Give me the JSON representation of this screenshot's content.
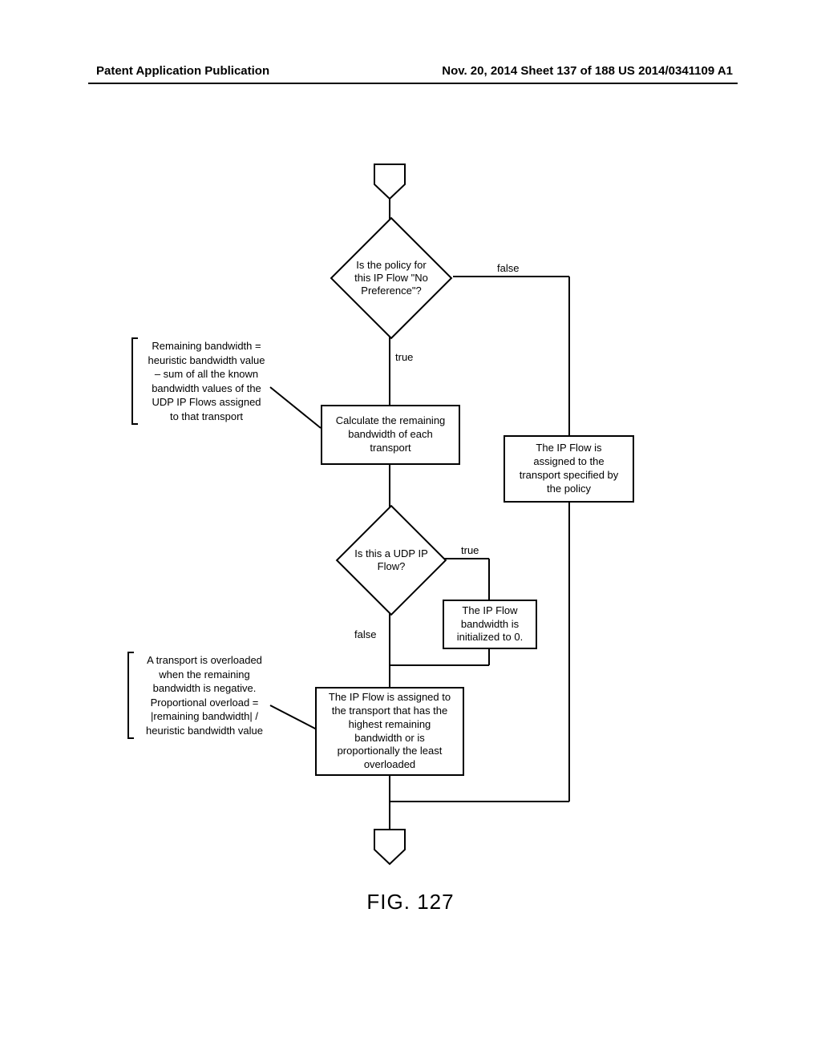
{
  "header": {
    "left": "Patent Application Publication",
    "right": "Nov. 20, 2014  Sheet 137 of 188   US 2014/0341109 A1"
  },
  "decision1": {
    "text": "Is the policy for\nthis IP Flow \"No\nPreference\"?",
    "true_label": "true",
    "false_label": "false"
  },
  "annot_bandwidth": "Remaining bandwidth =\nheuristic bandwidth value\n– sum of all the known\nbandwidth values of the\nUDP IP Flows assigned\nto that transport",
  "process_remaining": "Calculate the remaining\nbandwidth of each\ntransport",
  "process_policy_assign": "The IP Flow is\nassigned to the\ntransport specified by\nthe policy",
  "decision2": {
    "text": "Is this a UDP IP\nFlow?",
    "true_label": "true",
    "false_label": "false"
  },
  "process_init0": "The IP Flow\nbandwidth is\ninitialized to 0.",
  "annot_overload": "A transport is overloaded\nwhen the remaining\nbandwidth is negative.\nProportional overload =\n|remaining bandwidth| /\nheuristic bandwidth value",
  "process_assign_highest": "The IP Flow is assigned to\nthe transport that has the\nhighest remaining\nbandwidth or is\nproportionally the least\noverloaded",
  "figure_label": "FIG. 127"
}
